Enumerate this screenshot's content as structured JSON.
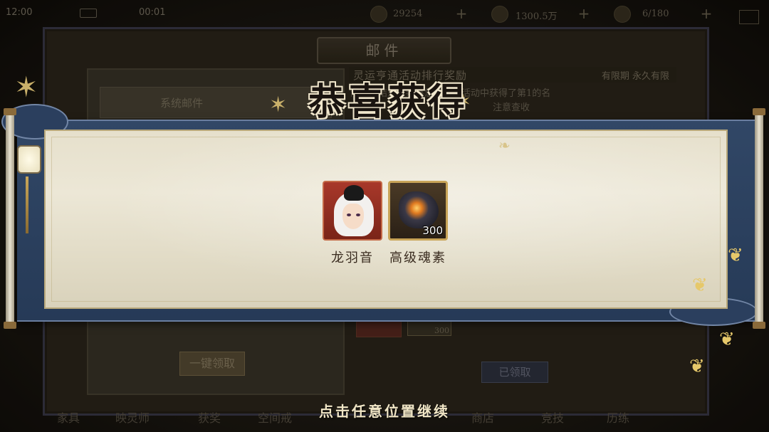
{
  "status_bar": {
    "time": "12:00",
    "clock": "00:01"
  },
  "resources": [
    {
      "icon": "gem-icon",
      "value": "29254"
    },
    {
      "icon": "coin-icon",
      "value": "1300.5万"
    },
    {
      "icon": "stamina-icon",
      "value": "6/180"
    }
  ],
  "mail": {
    "title": "邮件",
    "category": "系统邮件",
    "subject": "灵运亨通活动排行奖励",
    "expiry": "有限期 永久有限",
    "body_line1": "活动已结束，恭喜您在本次活动中获得了第1的名",
    "body_line2": "注意查收",
    "claim_all_label": "一键领取",
    "claimed_label": "已领取",
    "small_item_qty": "300"
  },
  "bottom_nav": [
    "家具",
    "映灵师",
    "获奖",
    "空间戒",
    "商店",
    "竞技",
    "历练"
  ],
  "popup": {
    "title": "恭喜获得",
    "rewards": [
      {
        "name": "龙羽音",
        "type": "hero",
        "qty": ""
      },
      {
        "name": "高级魂素",
        "type": "item",
        "qty": "300"
      }
    ],
    "continue_hint": "点击任意位置继续"
  },
  "colors": {
    "scroll_frame": "#314766",
    "paper": "#e6e0cc",
    "hero_frame": "#a8382a",
    "item_frame_border": "#c8a458",
    "hint_text": "#f1e6c6"
  }
}
